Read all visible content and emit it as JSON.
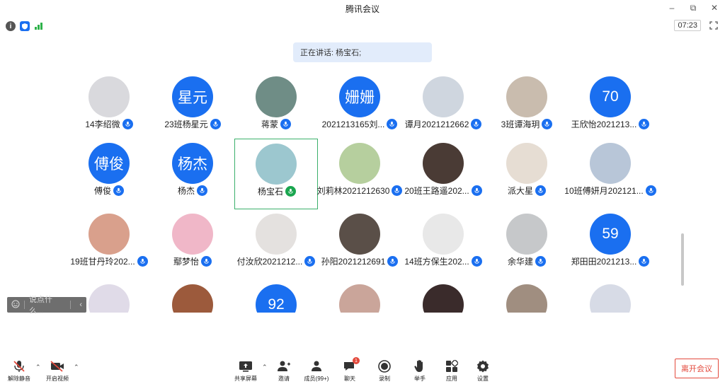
{
  "window": {
    "title": "腾讯会议"
  },
  "infobar": {
    "timer": "07:23"
  },
  "banner": {
    "speaking": "正在讲话: 杨宝石;"
  },
  "participants": [
    {
      "name": "14李绍微",
      "avatar_text": "",
      "blue": false,
      "color": "#d9d9dd"
    },
    {
      "name": "23班杨星元",
      "avatar_text": "星元",
      "blue": true,
      "color": "#1a6ff0"
    },
    {
      "name": "蒋蒙",
      "avatar_text": "",
      "blue": false,
      "color": "#6f8d86"
    },
    {
      "name": "2021213165刘...",
      "avatar_text": "姗姗",
      "blue": true,
      "color": "#1a6ff0"
    },
    {
      "name": "谭月2021212662",
      "avatar_text": "",
      "blue": false,
      "color": "#cfd6df"
    },
    {
      "name": "3班谭海玥",
      "avatar_text": "",
      "blue": false,
      "color": "#c9bcae"
    },
    {
      "name": "王欣怡2021213...",
      "avatar_text": "70",
      "blue": true,
      "color": "#1a6ff0"
    },
    {
      "name": "傅俊",
      "avatar_text": "傅俊",
      "blue": true,
      "color": "#1a6ff0"
    },
    {
      "name": "杨杰",
      "avatar_text": "杨杰",
      "blue": true,
      "color": "#1a6ff0"
    },
    {
      "name": "杨宝石",
      "avatar_text": "",
      "blue": false,
      "color": "#9cc7cf"
    },
    {
      "name": "刘莉林2021212630",
      "avatar_text": "",
      "blue": false,
      "color": "#b6cf9e"
    },
    {
      "name": "20班王路遥202...",
      "avatar_text": "",
      "blue": false,
      "color": "#4a3b35"
    },
    {
      "name": "派大星",
      "avatar_text": "",
      "blue": false,
      "color": "#e6ddd3"
    },
    {
      "name": "10班傅妍月202121...",
      "avatar_text": "",
      "blue": false,
      "color": "#b8c6d8"
    },
    {
      "name": "19班甘丹玲202...",
      "avatar_text": "",
      "blue": false,
      "color": "#d9a08c"
    },
    {
      "name": "鄢梦怡",
      "avatar_text": "",
      "blue": false,
      "color": "#f0b7c8"
    },
    {
      "name": "付汝欣2021212...",
      "avatar_text": "",
      "blue": false,
      "color": "#e4e1df"
    },
    {
      "name": "孙阳2021212691",
      "avatar_text": "",
      "blue": false,
      "color": "#5a4f48"
    },
    {
      "name": "14班方保生202...",
      "avatar_text": "",
      "blue": false,
      "color": "#e8e8e8"
    },
    {
      "name": "余华建",
      "avatar_text": "",
      "blue": false,
      "color": "#c6c8ca"
    },
    {
      "name": "郑田田2021213...",
      "avatar_text": "59",
      "blue": true,
      "color": "#1a6ff0"
    },
    {
      "name": "",
      "avatar_text": "",
      "blue": false,
      "color": "#e0dbe8"
    },
    {
      "name": "",
      "avatar_text": "",
      "blue": false,
      "color": "#9c5a3c"
    },
    {
      "name": "",
      "avatar_text": "92",
      "blue": true,
      "color": "#1a6ff0"
    },
    {
      "name": "",
      "avatar_text": "",
      "blue": false,
      "color": "#caa59a"
    },
    {
      "name": "",
      "avatar_text": "",
      "blue": false,
      "color": "#3a2b2b"
    },
    {
      "name": "",
      "avatar_text": "",
      "blue": false,
      "color": "#a08e80"
    },
    {
      "name": "",
      "avatar_text": "",
      "blue": false,
      "color": "#d7dbe6"
    }
  ],
  "chat": {
    "placeholder": "说点什么..."
  },
  "toolbar": {
    "unmute": "解除静音",
    "start_video": "开启视频",
    "share_screen": "共享屏幕",
    "invite": "邀请",
    "members": "成员(99+)",
    "chat": "聊天",
    "chat_badge": "1",
    "record": "录制",
    "raise_hand": "举手",
    "apps": "应用",
    "settings": "设置",
    "leave": "离开会议"
  },
  "colors": {
    "accent": "#1a6ff0",
    "speaking_green": "#1aa64f",
    "leave_red": "#e3493c",
    "banner_bg": "#e2ecfb"
  }
}
